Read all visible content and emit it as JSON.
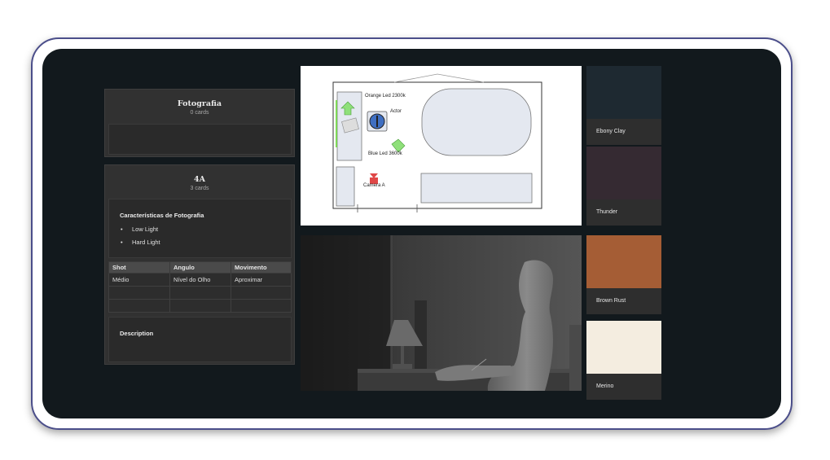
{
  "cards": {
    "fotografia": {
      "title": "Fotografia",
      "count": "0 cards"
    },
    "shot4a": {
      "title": "4A",
      "count": "3 cards",
      "characteristics_title": "Características de Fotografia",
      "characteristics": [
        "Low Light",
        "Hard Light"
      ],
      "table": {
        "headers": [
          "Shot",
          "Angulo",
          "Movimento"
        ],
        "rows": [
          [
            "Médio",
            "Nível do Olho",
            "Aproximar"
          ],
          [
            "",
            "",
            ""
          ],
          [
            "",
            "",
            ""
          ]
        ]
      },
      "description_title": "Description"
    }
  },
  "diagram": {
    "labels": {
      "orange_led": "Orange Led 2300k",
      "actor": "Actor",
      "blue_led": "Blue Led 3600k",
      "camera": "Camera A"
    }
  },
  "swatches": [
    {
      "name": "Ebony Clay",
      "color": "#1e2931"
    },
    {
      "name": "Thunder",
      "color": "#352a32"
    },
    {
      "name": "Brown Rust",
      "color": "#a55d35"
    },
    {
      "name": "Merino",
      "color": "#f4ede0"
    }
  ]
}
